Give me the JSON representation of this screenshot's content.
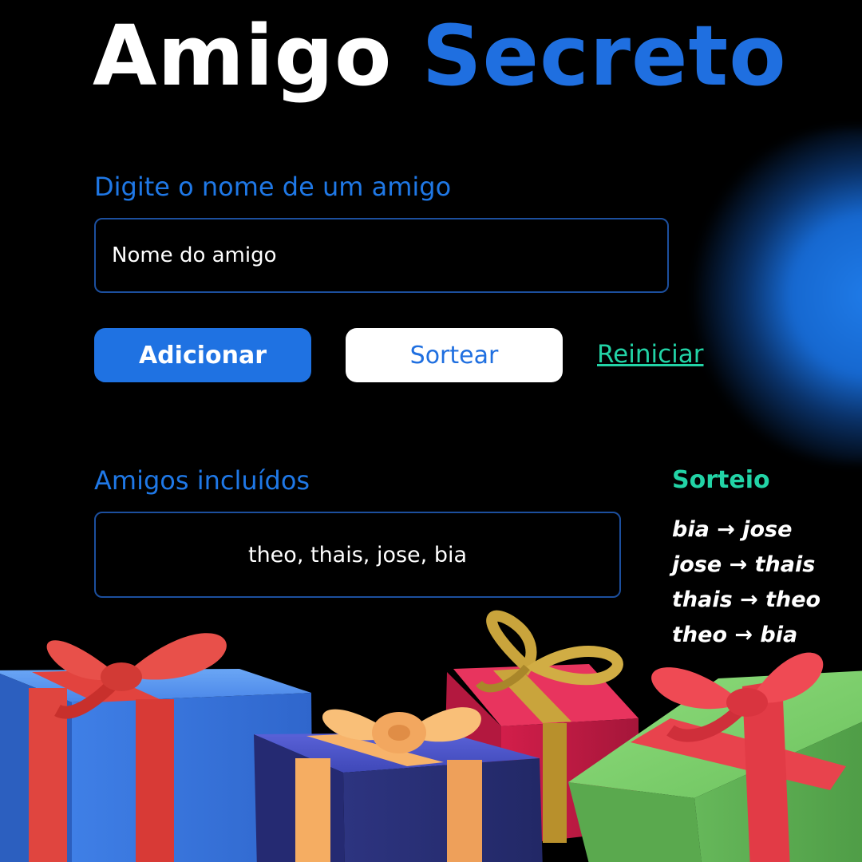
{
  "title": {
    "word1": "Amigo",
    "word2": "Secreto"
  },
  "form": {
    "label": "Digite o nome de um amigo",
    "placeholder": "Nome do amigo"
  },
  "buttons": {
    "add": "Adicionar",
    "draw": "Sortear",
    "reset": "Reiniciar"
  },
  "friends": {
    "heading": "Amigos incluídos",
    "list_text": "theo, thais, jose, bia"
  },
  "draw_result": {
    "heading": "Sorteio",
    "pairs": [
      "bia → jose",
      "jose → thais",
      "thais → theo",
      "theo → bia"
    ]
  },
  "colors": {
    "background": "#000000",
    "accent_blue": "#1f6fe0",
    "accent_green": "#22d3a6"
  },
  "decorations": [
    "blue-gift-box",
    "navy-gift-box",
    "red-gift-box",
    "green-gift-box"
  ]
}
